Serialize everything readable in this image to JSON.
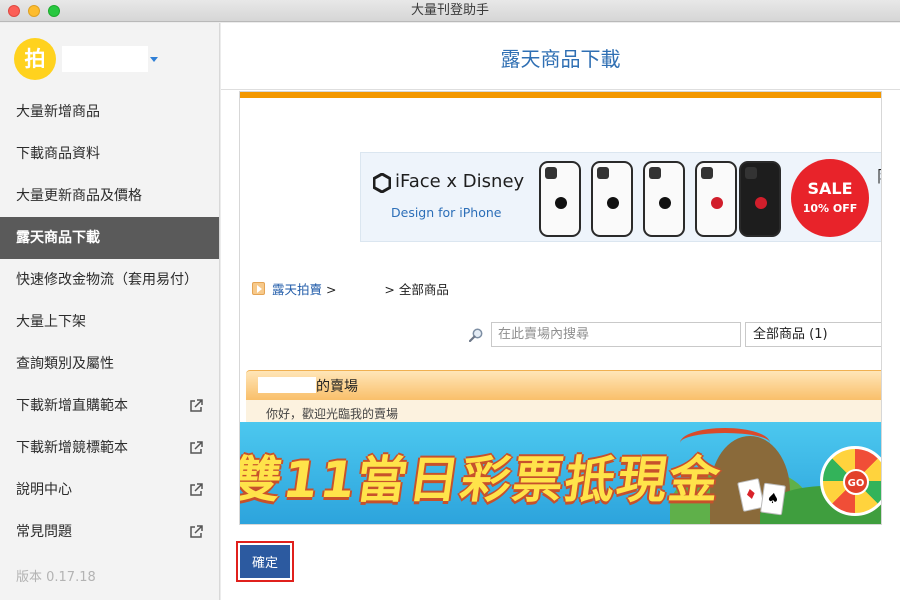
{
  "window": {
    "title": "大量刊登助手"
  },
  "sidebar": {
    "avatar_char": "拍",
    "items": [
      {
        "label": "大量新增商品"
      },
      {
        "label": "下載商品資料"
      },
      {
        "label": "大量更新商品及價格"
      },
      {
        "label": "露天商品下載",
        "active": true
      },
      {
        "label": "快速修改金物流（套用易付）"
      },
      {
        "label": "大量上下架"
      },
      {
        "label": "查詢類別及屬性"
      },
      {
        "label": "下載新增直購範本",
        "external": true
      },
      {
        "label": "下載新增競標範本",
        "external": true
      },
      {
        "label": "說明中心",
        "external": true
      },
      {
        "label": "常見問題",
        "external": true
      }
    ],
    "version": "版本 0.17.18"
  },
  "main": {
    "title": "露天商品下載",
    "banner": {
      "brand": "iFace x Disney",
      "tagline": "Design for iPhone",
      "sale_big": "SALE",
      "sale_small": "10% OFF",
      "tail_char": "限"
    },
    "breadcrumb": {
      "link": "露天拍賣",
      "sep1": " > ",
      "sep2": " > ",
      "current": "全部商品"
    },
    "search": {
      "placeholder": "在此賣場內搜尋"
    },
    "category_select": "全部商品 (1)",
    "store_suffix": "的賣場",
    "welcome_text": "你好，歡迎光臨我的賣場",
    "promo_text": "雙11當日彩票抵現金",
    "promo_go": "GO",
    "confirm_label": "確定"
  },
  "colors": {
    "accent_blue": "#2f6fb3",
    "active_item_bg": "#5a5a5a",
    "orange_bar": "#f39800",
    "confirm_bg": "#2c5aa0",
    "highlight_red": "#e0201c"
  }
}
